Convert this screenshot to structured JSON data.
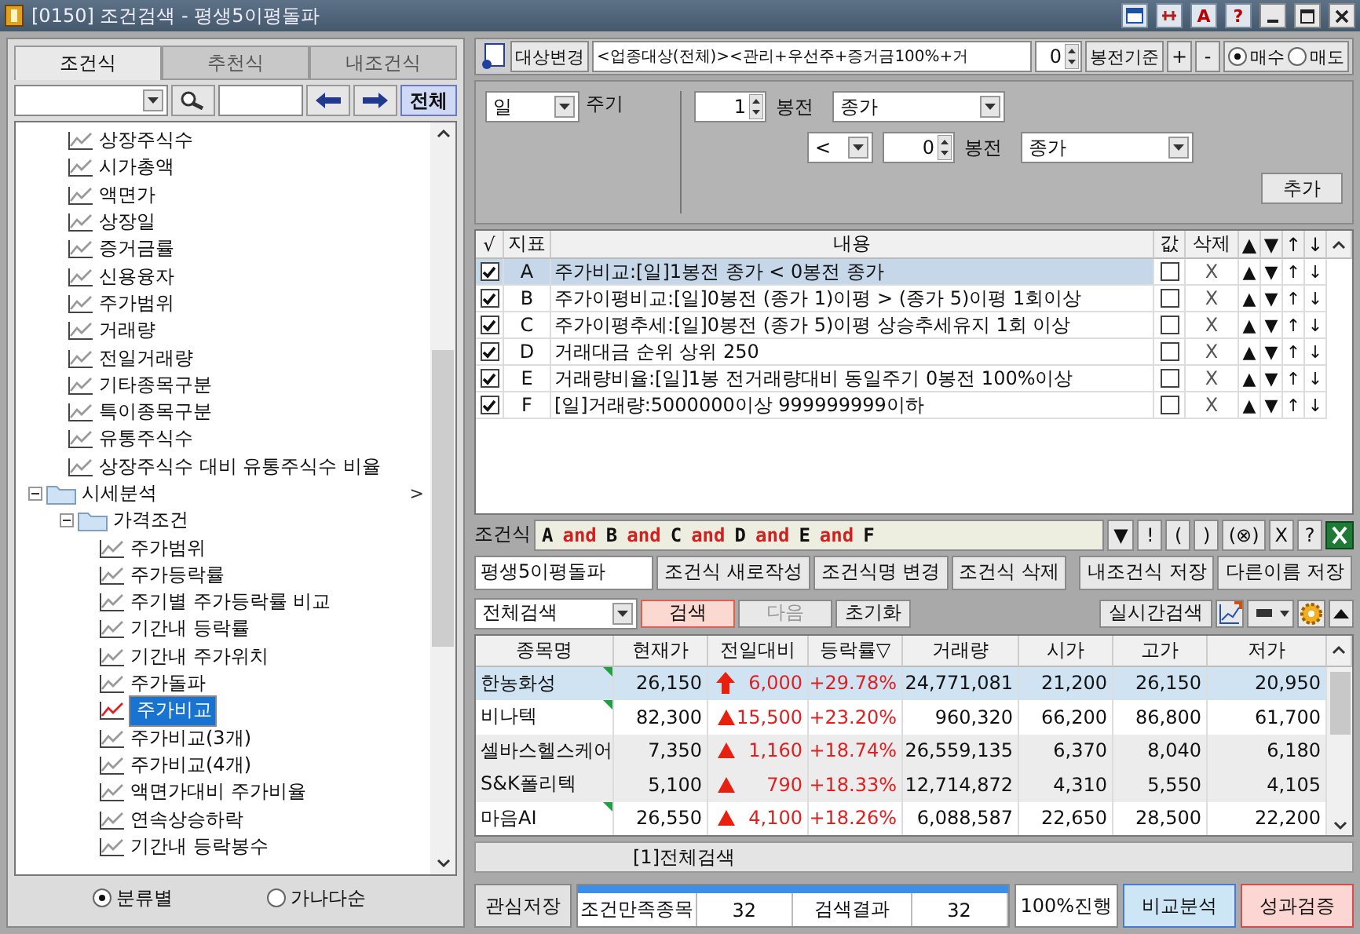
{
  "window": {
    "title": "[0150] 조건검색 - 평생5이평돌파",
    "tools": [
      "A",
      "?"
    ]
  },
  "left_panel": {
    "tabs": [
      {
        "label": "조건식",
        "selected": true
      },
      {
        "label": "추천식",
        "selected": false
      },
      {
        "label": "내조건식",
        "selected": false
      }
    ],
    "all_button": "전체",
    "scroll_marker": ">",
    "tree": [
      {
        "children": [
          {
            "label": "상장주식수",
            "selected": false
          },
          {
            "label": "시가총액",
            "selected": false
          },
          {
            "label": "액면가",
            "selected": false
          },
          {
            "label": "상장일",
            "selected": false
          },
          {
            "label": "증거금률",
            "selected": false
          },
          {
            "label": "신용융자",
            "selected": false
          },
          {
            "label": "주가범위",
            "selected": false
          },
          {
            "label": "거래량",
            "selected": false
          },
          {
            "label": "전일거래량",
            "selected": false
          },
          {
            "label": "기타종목구분",
            "selected": false
          },
          {
            "label": "특이종목구분",
            "selected": false
          },
          {
            "label": "유통주식수",
            "selected": false
          },
          {
            "label": "상장주식수 대비 유통주식수 비율",
            "selected": false
          }
        ]
      },
      {
        "label": "시세분석",
        "expanded": true,
        "children": [
          {
            "label": "가격조건",
            "expanded": true,
            "children": [
              {
                "label": "주가범위",
                "selected": false
              },
              {
                "label": "주가등락률",
                "selected": false
              },
              {
                "label": "주기별 주가등락률 비교",
                "selected": false
              },
              {
                "label": "기간내 등락률",
                "selected": false
              },
              {
                "label": "기간내 주가위치",
                "selected": false
              },
              {
                "label": "주가돌파",
                "selected": false
              },
              {
                "label": "주가비교",
                "selected": true
              },
              {
                "label": "주가비교(3개)",
                "selected": false
              },
              {
                "label": "주가비교(4개)",
                "selected": false
              },
              {
                "label": "액면가대비 주가비율",
                "selected": false
              },
              {
                "label": "연속상승하락",
                "selected": false
              },
              {
                "label": "기간내 등락봉수",
                "selected": false
              }
            ]
          }
        ]
      }
    ],
    "sort_options": [
      {
        "label": "분류별",
        "selected": true
      },
      {
        "label": "가나다순",
        "selected": false
      }
    ]
  },
  "target": {
    "button": "대상변경",
    "text": "<업종대상(전체)><관리+우선주+증거금100%+거",
    "spin_value": "0",
    "base_button": "봉전기준",
    "plus": "+",
    "minus": "-",
    "trade_options": [
      {
        "label": "매수",
        "selected": true
      },
      {
        "label": "매도",
        "selected": false
      }
    ]
  },
  "params": {
    "period": "일",
    "period_label": "주기",
    "spin1": "1",
    "bar_label1": "봉전",
    "price1": "종가",
    "operator": "<",
    "spin2": "0",
    "bar_label2": "봉전",
    "price2": "종가",
    "add_button": "추가"
  },
  "conditions": {
    "columns": [
      "√",
      "지표",
      "내용",
      "값",
      "삭제",
      "▲",
      "▼",
      "↑",
      "↓"
    ],
    "rows": [
      {
        "checked": true,
        "letter": "A",
        "content": "주가비교:[일]1봉전 종가 < 0봉전 종가",
        "value_checked": false,
        "delete": "X",
        "moves": [
          "▲",
          "▼",
          "↑",
          "↓"
        ],
        "selected": true
      },
      {
        "checked": true,
        "letter": "B",
        "content": "주가이평비교:[일]0봉전 (종가 1)이평 > (종가 5)이평 1회이상",
        "value_checked": false,
        "delete": "X",
        "moves": [
          "▲",
          "▼",
          "↑",
          "↓"
        ],
        "selected": false
      },
      {
        "checked": true,
        "letter": "C",
        "content": "주가이평추세:[일]0봉전 (종가 5)이평 상승추세유지 1회 이상",
        "value_checked": false,
        "delete": "X",
        "moves": [
          "▲",
          "▼",
          "↑",
          "↓"
        ],
        "selected": false
      },
      {
        "checked": true,
        "letter": "D",
        "content": "거래대금 순위 상위 250",
        "value_checked": false,
        "delete": "X",
        "moves": [
          "▲",
          "▼",
          "↑",
          "↓"
        ],
        "selected": false
      },
      {
        "checked": true,
        "letter": "E",
        "content": "거래량비율:[일]1봉 전거래량대비 동일주기 0봉전 100%이상",
        "value_checked": false,
        "delete": "X",
        "moves": [
          "▲",
          "▼",
          "↑",
          "↓"
        ],
        "selected": false
      },
      {
        "checked": true,
        "letter": "F",
        "content": "[일]거래량:5000000이상 999999999이하",
        "value_checked": false,
        "delete": "X",
        "moves": [
          "▲",
          "▼",
          "↑",
          "↓"
        ],
        "selected": false
      }
    ]
  },
  "formula": {
    "label": "조건식",
    "tokens": [
      {
        "text": "A",
        "kind": "operand"
      },
      {
        "text": "and",
        "kind": "operator"
      },
      {
        "text": "B",
        "kind": "operand"
      },
      {
        "text": "and",
        "kind": "operator"
      },
      {
        "text": "C",
        "kind": "operand"
      },
      {
        "text": "and",
        "kind": "operator"
      },
      {
        "text": "D",
        "kind": "operand"
      },
      {
        "text": "and",
        "kind": "operator"
      },
      {
        "text": "E",
        "kind": "operand"
      },
      {
        "text": "and",
        "kind": "operator"
      },
      {
        "text": "F",
        "kind": "operand"
      }
    ],
    "buttons": [
      "▼",
      "!",
      "(",
      ")",
      "(⊗)",
      "X",
      "?"
    ]
  },
  "name_row": {
    "name": "평생5이평돌파",
    "buttons": [
      "조건식 새로작성",
      "조건식명 변경",
      "조건식 삭제",
      "내조건식 저장",
      "다른이름 저장"
    ]
  },
  "search_bar": {
    "scope": "전체검색",
    "buttons": [
      {
        "label": "검색",
        "highlighted": true,
        "disabled": false
      },
      {
        "label": "다음",
        "highlighted": false,
        "disabled": true
      },
      {
        "label": "초기화",
        "highlighted": false,
        "disabled": false
      }
    ],
    "realtime_button": "실시간검색"
  },
  "results": {
    "columns": [
      "종목명",
      "현재가",
      "전일대비",
      "등락률▽",
      "거래량",
      "시가",
      "고가",
      "저가"
    ],
    "rows": [
      {
        "name": "한농화성",
        "price": "26,150",
        "kind": "limit_up",
        "change": "6,000",
        "rate": "+29.78%",
        "volume": "24,771,081",
        "open": "21,200",
        "high": "26,150",
        "low": "20,950",
        "flagged": true,
        "selected": true
      },
      {
        "name": "비나텍",
        "price": "82,300",
        "kind": "up",
        "change": "15,500",
        "rate": "+23.20%",
        "volume": "960,320",
        "open": "66,200",
        "high": "86,800",
        "low": "61,700",
        "flagged": true,
        "selected": false
      },
      {
        "name": "셀바스헬스케어",
        "price": "7,350",
        "kind": "up",
        "change": "1,160",
        "rate": "+18.74%",
        "volume": "26,559,135",
        "open": "6,370",
        "high": "8,040",
        "low": "6,180",
        "flagged": false,
        "selected": false
      },
      {
        "name": "S&K폴리텍",
        "price": "5,100",
        "kind": "up",
        "change": "790",
        "rate": "+18.33%",
        "volume": "12,714,872",
        "open": "4,310",
        "high": "5,550",
        "low": "4,105",
        "flagged": false,
        "selected": false
      },
      {
        "name": "마음AI",
        "price": "26,550",
        "kind": "up",
        "change": "4,100",
        "rate": "+18.26%",
        "volume": "6,088,587",
        "open": "22,650",
        "high": "28,500",
        "low": "22,200",
        "flagged": true,
        "selected": false
      }
    ]
  },
  "status_text": "[1]전체검색",
  "bottom": {
    "save_button": "관심저장",
    "progress": {
      "level": 1
    },
    "cells": [
      "조건만족종목",
      "32",
      "검색결과",
      "32"
    ],
    "progress_text": "100%진행",
    "compare_button": "비교분석",
    "verify_button": "성과검증"
  }
}
